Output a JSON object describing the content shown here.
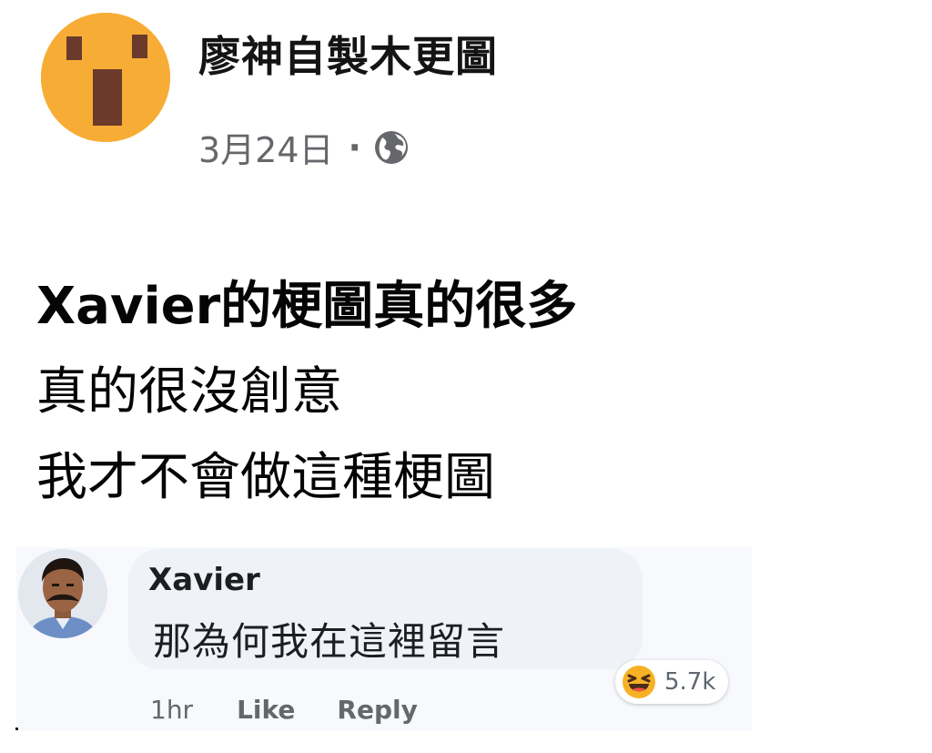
{
  "post": {
    "page_name": "廖神自製木更圖",
    "date": "3月24日",
    "separator": "·",
    "privacy_icon": "globe-icon",
    "avatar_icon": "surprised-face-icon",
    "avatar_color": "#f7ad35",
    "lines": [
      "Xavier的梗圖真的很多",
      "真的很沒創意",
      "我才不會做這種梗圖"
    ]
  },
  "comment": {
    "author": "Xavier",
    "avatar_icon": "user-photo-avatar",
    "text": "那為何我在這裡留言",
    "reaction_icon": "haha-reaction-icon",
    "reaction_count": "5.7k",
    "time": "1hr",
    "like_label": "Like",
    "reply_label": "Reply"
  },
  "colors": {
    "text_primary": "#050505",
    "text_secondary": "#65676b",
    "bubble_bg": "#eff2f7",
    "haha_yellow": "#f7b125"
  }
}
